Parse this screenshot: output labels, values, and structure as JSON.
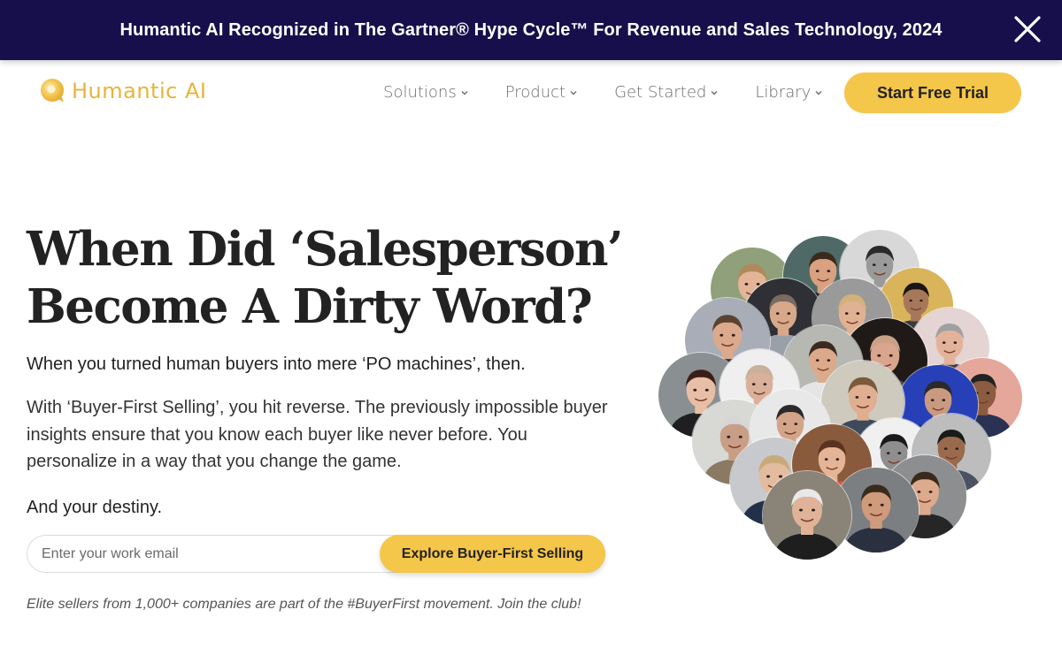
{
  "announcement": {
    "text": "Humantic AI Recognized in The Gartner® Hype Cycle™ For Revenue and Sales Technology, 2024",
    "close_icon": "close-icon",
    "background": "#170f4c"
  },
  "header": {
    "brand": "Humantic AI",
    "brand_color": "#e8b43a",
    "nav": [
      {
        "label": "Solutions",
        "icon": "chevron-down-icon"
      },
      {
        "label": "Product",
        "icon": "chevron-down-icon"
      },
      {
        "label": "Get Started",
        "icon": "chevron-down-icon"
      },
      {
        "label": "Library",
        "icon": "chevron-down-icon"
      }
    ],
    "cta_label": "Start Free Trial",
    "accent": "#f4c64a"
  },
  "hero": {
    "title_line1": "When Did ‘Salesperson’",
    "title_line2": "Become A Dirty Word?",
    "subtitle": "When you turned human buyers into mere ‘PO machines’, then.",
    "body": "With ‘Buyer-First Selling’, you hit reverse. The previously impossible buyer insights ensure that you know each buyer like never before. You personalize in a way that you change the game.",
    "destiny": "And your destiny.",
    "email_placeholder": "Enter your work email",
    "email_value": "",
    "submit_label": "Explore Buyer-First Selling",
    "note": "Elite sellers from 1,000+ companies are part of the #BuyerFirst movement. Join the club!"
  },
  "collage": {
    "description": "Cluster of circular portrait photos of sellers",
    "faces": [
      {
        "bg": "#8fa07a",
        "skin": "#e3b596",
        "hair": "#b08a5a",
        "shirt": "#e9e9ef"
      },
      {
        "bg": "#4f6a66",
        "skin": "#d9a17f",
        "hair": "#3a2a1e",
        "shirt": "#2a2a2a"
      },
      {
        "bg": "#d8d8d8",
        "skin": "#9a9a9a",
        "hair": "#2a2a2a",
        "shirt": "#cfcfcf"
      },
      {
        "bg": "#d9b45a",
        "skin": "#a7775a",
        "hair": "#1c1410",
        "shirt": "#3a3a3a"
      },
      {
        "bg": "#2f2f36",
        "skin": "#d7a88a",
        "hair": "#7a6a60",
        "shirt": "#9aa0a8"
      },
      {
        "bg": "#9a9a9a",
        "skin": "#e1b194",
        "hair": "#d2b27a",
        "shirt": "#6a5a5a"
      },
      {
        "bg": "#a9adb8",
        "skin": "#dba98c",
        "hair": "#5c4330",
        "shirt": "#2e3040"
      },
      {
        "bg": "#e4d4d4",
        "skin": "#e2b39a",
        "hair": "#a0a0a0",
        "shirt": "#3a3a4a"
      },
      {
        "bg": "#1f1a18",
        "skin": "#d9a58c",
        "hair": "#c9a285",
        "shirt": "#4a4a4a"
      },
      {
        "bg": "#b8b8b2",
        "skin": "#dcaa8a",
        "hair": "#3b2a20",
        "shirt": "#e5e5e5"
      },
      {
        "bg": "#8a8f92",
        "skin": "#e7bfa6",
        "hair": "#3a1f16",
        "shirt": "#1f1f1f"
      },
      {
        "bg": "#efefef",
        "skin": "#d9b09a",
        "hair": "#c9b09a",
        "shirt": "#555555"
      },
      {
        "bg": "#e5a79a",
        "skin": "#8c5c40",
        "hair": "#222222",
        "shirt": "#2a3152"
      },
      {
        "bg": "#2740b8",
        "skin": "#c99a80",
        "hair": "#2a2a2a",
        "shirt": "#1a2a80"
      },
      {
        "bg": "#cfcabe",
        "skin": "#e0ae90",
        "hair": "#7a5a3a",
        "shirt": "#3c4a5a"
      },
      {
        "bg": "#d8d8d4",
        "skin": "#c99e86",
        "hair": "#d6d6d6",
        "shirt": "#8a7a64"
      },
      {
        "bg": "#e8e8e8",
        "skin": "#d3a488",
        "hair": "#2a2a2a",
        "shirt": "#5a5a5a"
      },
      {
        "bg": "#f0f0f0",
        "skin": "#8e8e8e",
        "hair": "#1a1a1a",
        "shirt": "#1a1a1a"
      },
      {
        "bg": "#bdbdbd",
        "skin": "#9a6a4c",
        "hair": "#1a1a1a",
        "shirt": "#4a5262"
      },
      {
        "bg": "#c7c9cc",
        "skin": "#e3bb9e",
        "hair": "#c9a97a",
        "shirt": "#22304a"
      },
      {
        "bg": "#8a5a3c",
        "skin": "#e4b497",
        "hair": "#5a3420",
        "shirt": "#d4543a"
      },
      {
        "bg": "#8c8e90",
        "skin": "#dcaa8c",
        "hair": "#3a2a1c",
        "shirt": "#262626"
      },
      {
        "bg": "#7c7f82",
        "skin": "#cf9b7c",
        "hair": "#3a2a1c",
        "shirt": "#2a3040"
      },
      {
        "bg": "#8a8478",
        "skin": "#e0b398",
        "hair": "#e8e8e8",
        "shirt": "#1e1e1e"
      }
    ]
  }
}
